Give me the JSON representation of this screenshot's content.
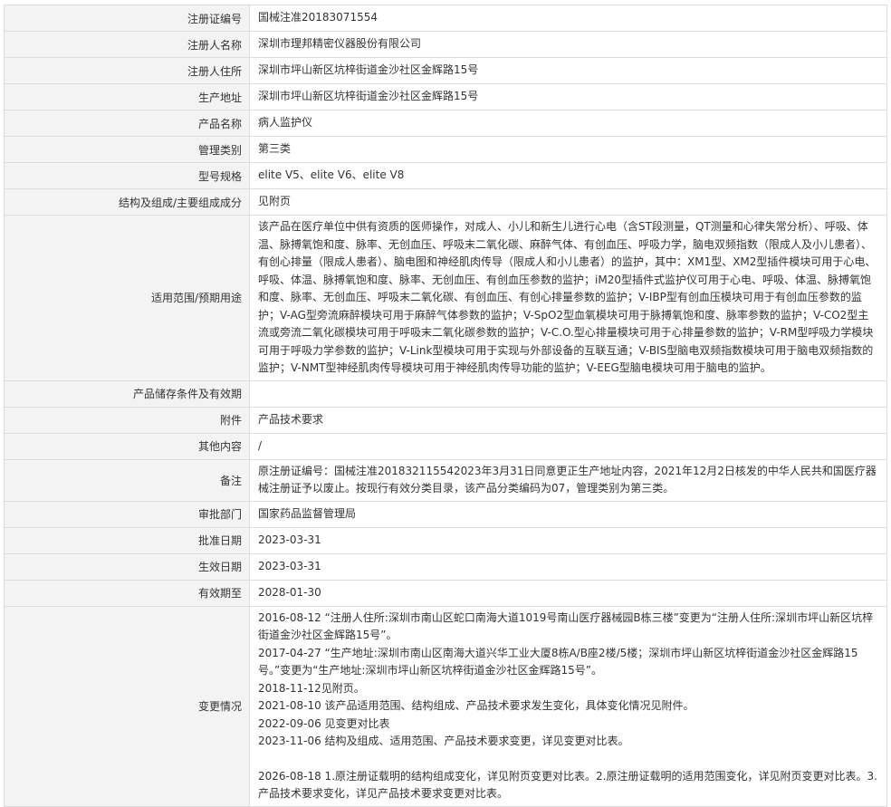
{
  "rows": [
    {
      "label": "注册证编号",
      "value": "国械注准20183071554"
    },
    {
      "label": "注册人名称",
      "value": "深圳市理邦精密仪器股份有限公司"
    },
    {
      "label": "注册人住所",
      "value": "深圳市坪山新区坑梓街道金沙社区金辉路15号"
    },
    {
      "label": "生产地址",
      "value": "深圳市坪山新区坑梓街道金沙社区金辉路15号"
    },
    {
      "label": "产品名称",
      "value": "病人监护仪"
    },
    {
      "label": "管理类别",
      "value": "第三类"
    },
    {
      "label": "型号规格",
      "value": "elite V5、elite V6、elite V8"
    },
    {
      "label": "结构及组成/主要组成成分",
      "value": "见附页"
    },
    {
      "label": "适用范围/预期用途",
      "value": "该产品在医疗单位中供有资质的医师操作，对成人、小儿和新生儿进行心电（含ST段测量，QT测量和心律失常分析）、呼吸、体温、脉搏氧饱和度、脉率、无创血压、呼吸末二氧化碳、麻醉气体、有创血压、呼吸力学，脑电双频指数（限成人及小儿患者）、有创心排量（限成人患者）、脑电图和神经肌肉传导（限成人和小儿患者）的监护，其中：XM1型、XM2型插件模块可用于心电、呼吸、体温、脉搏氧饱和度、脉率、无创血压、有创血压参数的监护；iM20型插件式监护仪可用于心电、呼吸、体温、脉搏氧饱和度、脉率、无创血压、呼吸末二氧化碳、有创血压、有创心排量参数的监护；V-IBP型有创血压模块可用于有创血压参数的监护；V-AG型旁流麻醉模块可用于麻醉气体参数的监护；V-SpO2型血氧模块可用于脉搏氧饱和度、脉率参数的监护；V-CO2型主流或旁流二氧化碳模块可用于呼吸末二氧化碳参数的监护；V-C.O.型心排量模块可用于心排量参数的监护；V-RM型呼吸力学模块可用于呼吸力学参数的监护；V-Link型模块可用于实现与外部设备的互联互通；V-BIS型脑电双频指数模块可用于脑电双频指数的监护；V-NMT型神经肌肉传导模块可用于神经肌肉传导功能的监护；V-EEG型脑电模块可用于脑电的监护。"
    },
    {
      "label": "产品储存条件及有效期",
      "value": ""
    },
    {
      "label": "附件",
      "value": "产品技术要求"
    },
    {
      "label": "其他内容",
      "value": "/"
    },
    {
      "label": "备注",
      "value": "原注册证编号：国械注准20183211554​2023年3月31日同意更正生产地址内容，2021年12月2日核发的中华人民共和国医疗器械注册证予以废止。按现行有效分类目录，该产品分类编码为07，管理类别为第三类。"
    },
    {
      "label": "审批部门",
      "value": "国家药品监督管理局"
    },
    {
      "label": "批准日期",
      "value": "2023-03-31"
    },
    {
      "label": "生效日期",
      "value": "2023-03-31"
    },
    {
      "label": "有效期至",
      "value": "2028-01-30"
    },
    {
      "label": "变更情况",
      "value": ""
    }
  ],
  "changes": [
    "2016-08-12 “注册人住所:深圳市南山区蛇口南海大道1019号南山医疗器械园B栋三楼”变更为“注册人住所:深圳市坪山新区坑梓街道金沙社区金辉路15号”。",
    "2017-04-27 “生产地址:深圳市南山区南海大道兴华工业大厦8栋A/B座2楼/5楼；深圳市坪山新区坑梓街道金沙社区金辉路15号。”变更为“生产地址:深圳市坪山新区坑梓街道金沙社区金辉路15号”。",
    "2018-11-12见附页。",
    "2021-08-10 该产品适用范围、结构组成、产品技术要求发生变化，具体变化情况见附件。",
    "2022-09-06 见变更对比表",
    "2023-11-06 结构及组成、适用范围、产品技术要求变更，详见变更对比表。",
    "2026-08-18 1.原注册证载明的结构组成变化，详见附页变更对比表。2.原注册证载明的适用范围变化，详见附页变更对比表。3.产品技术要求变化，详见产品技术要求变更对比表。"
  ]
}
